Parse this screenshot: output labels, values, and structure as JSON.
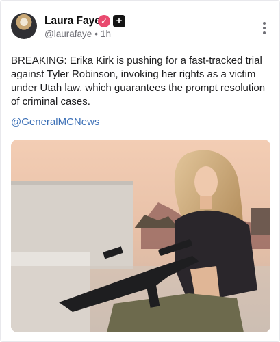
{
  "post": {
    "author": {
      "name": "Laura Faye",
      "handle": "@laurafaye",
      "time": "1h",
      "separator": "•"
    },
    "text": "BREAKING: Erika Kirk is pushing for a fast-tracked trial against Tyler Robinson, invoking her rights as a victim under Utah law, which guarantees the prompt resolution of criminal cases.",
    "mention": "@GeneralMCNews",
    "icons": {
      "verified": "verified-badge-icon",
      "plus": "plus-badge-icon",
      "menu": "more-vertical-icon"
    },
    "colors": {
      "verified": "#e94a6f",
      "mention": "#3b6fb6",
      "meta_text": "#6f6f76"
    }
  }
}
